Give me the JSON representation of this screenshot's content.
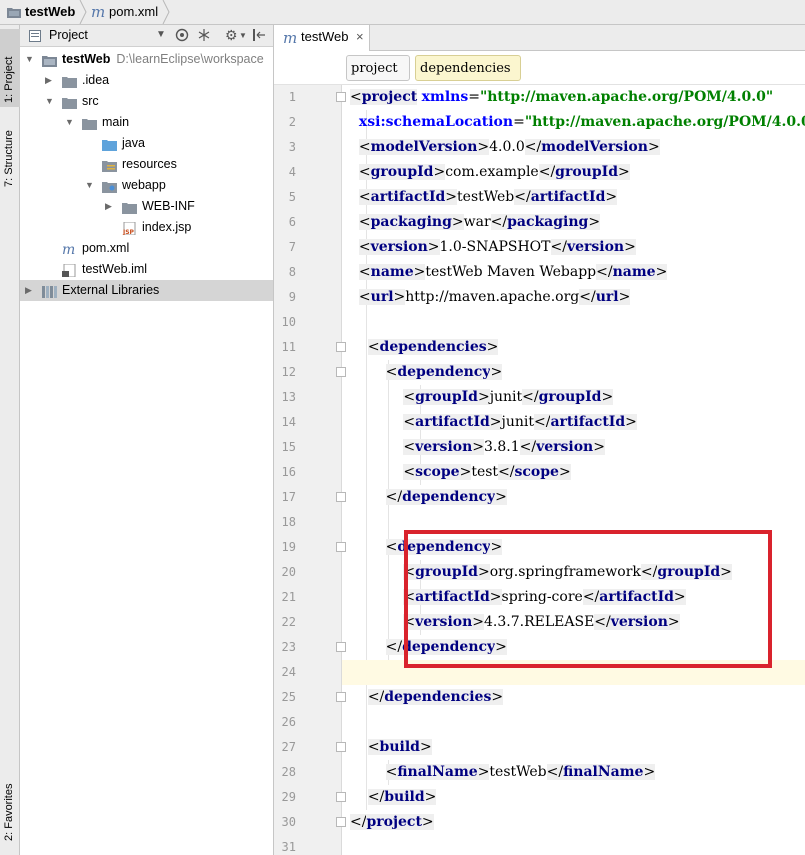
{
  "breadcrumb": {
    "project": "testWeb",
    "file": "pom.xml"
  },
  "leftstrip": {
    "project_tab": "1: Project",
    "structure_tab": "7: Structure",
    "favorites_tab": "2: Favorites"
  },
  "project_panel": {
    "title": "Project",
    "tree": [
      {
        "label": "testWeb",
        "path": "D:\\learnEclipse\\workspace",
        "indent": 0,
        "arrow": "▼",
        "icon": "module-folder-icon",
        "bold": true
      },
      {
        "label": ".idea",
        "indent": 1,
        "arrow": "▶",
        "icon": "folder-icon"
      },
      {
        "label": "src",
        "indent": 1,
        "arrow": "▼",
        "icon": "folder-icon"
      },
      {
        "label": "main",
        "indent": 2,
        "arrow": "▼",
        "icon": "folder-icon"
      },
      {
        "label": "java",
        "indent": 3,
        "arrow": "",
        "icon": "source-folder-icon"
      },
      {
        "label": "resources",
        "indent": 3,
        "arrow": "",
        "icon": "resources-folder-icon"
      },
      {
        "label": "webapp",
        "indent": 3,
        "arrow": "▼",
        "icon": "web-folder-icon"
      },
      {
        "label": "WEB-INF",
        "indent": 4,
        "arrow": "▶",
        "icon": "folder-icon"
      },
      {
        "label": "index.jsp",
        "indent": 4,
        "arrow": "",
        "icon": "jsp-file-icon"
      },
      {
        "label": "pom.xml",
        "indent": 1,
        "arrow": "",
        "icon": "maven-file-icon"
      },
      {
        "label": "testWeb.iml",
        "indent": 1,
        "arrow": "",
        "icon": "iml-file-icon"
      },
      {
        "label": "External Libraries",
        "indent": 0,
        "arrow": "▶",
        "icon": "libraries-icon",
        "selected": true
      }
    ]
  },
  "editor": {
    "tab_label": "testWeb",
    "tab_close": "×",
    "tag_breadcrumbs": [
      "project",
      "dependencies"
    ],
    "line_numbers": [
      "1",
      "2",
      "3",
      "4",
      "5",
      "6",
      "7",
      "8",
      "9",
      "10",
      "11",
      "12",
      "13",
      "14",
      "15",
      "16",
      "17",
      "18",
      "19",
      "20",
      "21",
      "22",
      "23",
      "24",
      "25",
      "26",
      "27",
      "28",
      "29",
      "30",
      "31"
    ],
    "current_line": 24
  },
  "code_lines": [
    [
      [
        "br",
        "<"
      ],
      [
        "tg",
        "project"
      ],
      [
        "txt",
        " "
      ],
      [
        "attr",
        "xmlns"
      ],
      [
        "txt",
        "="
      ],
      [
        "aval",
        "\"http://maven.apache.org/POM/4.0.0\""
      ]
    ],
    [
      [
        "txt",
        "  "
      ],
      [
        "attr",
        "xsi:schemaLocation"
      ],
      [
        "txt",
        "="
      ],
      [
        "aval",
        "\"http://maven.apache.org/POM/4.0.0"
      ]
    ],
    [
      [
        "txt",
        "  "
      ],
      [
        "br",
        "<"
      ],
      [
        "tg",
        "modelVersion"
      ],
      [
        "br",
        ">"
      ],
      [
        "txt",
        "4.0.0"
      ],
      [
        "br",
        "</"
      ],
      [
        "tg",
        "modelVersion"
      ],
      [
        "br",
        ">"
      ]
    ],
    [
      [
        "txt",
        "  "
      ],
      [
        "br",
        "<"
      ],
      [
        "tg",
        "groupId"
      ],
      [
        "br",
        ">"
      ],
      [
        "txt",
        "com.example"
      ],
      [
        "br",
        "</"
      ],
      [
        "tg",
        "groupId"
      ],
      [
        "br",
        ">"
      ]
    ],
    [
      [
        "txt",
        "  "
      ],
      [
        "br",
        "<"
      ],
      [
        "tg",
        "artifactId"
      ],
      [
        "br",
        ">"
      ],
      [
        "txt",
        "testWeb"
      ],
      [
        "br",
        "</"
      ],
      [
        "tg",
        "artifactId"
      ],
      [
        "br",
        ">"
      ]
    ],
    [
      [
        "txt",
        "  "
      ],
      [
        "br",
        "<"
      ],
      [
        "tg",
        "packaging"
      ],
      [
        "br",
        ">"
      ],
      [
        "txt",
        "war"
      ],
      [
        "br",
        "</"
      ],
      [
        "tg",
        "packaging"
      ],
      [
        "br",
        ">"
      ]
    ],
    [
      [
        "txt",
        "  "
      ],
      [
        "br",
        "<"
      ],
      [
        "tg",
        "version"
      ],
      [
        "br",
        ">"
      ],
      [
        "txt",
        "1.0-SNAPSHOT"
      ],
      [
        "br",
        "</"
      ],
      [
        "tg",
        "version"
      ],
      [
        "br",
        ">"
      ]
    ],
    [
      [
        "txt",
        "  "
      ],
      [
        "br",
        "<"
      ],
      [
        "tg",
        "name"
      ],
      [
        "br",
        ">"
      ],
      [
        "txt",
        "testWeb Maven Webapp"
      ],
      [
        "br",
        "</"
      ],
      [
        "tg",
        "name"
      ],
      [
        "br",
        ">"
      ]
    ],
    [
      [
        "txt",
        "  "
      ],
      [
        "br",
        "<"
      ],
      [
        "tg",
        "url"
      ],
      [
        "br",
        ">"
      ],
      [
        "txt",
        "http://maven.apache.org"
      ],
      [
        "br",
        "</"
      ],
      [
        "tg",
        "url"
      ],
      [
        "br",
        ">"
      ]
    ],
    [],
    [
      [
        "txt",
        "    "
      ],
      [
        "br",
        "<"
      ],
      [
        "tg",
        "dependencies"
      ],
      [
        "br",
        ">"
      ]
    ],
    [
      [
        "txt",
        "        "
      ],
      [
        "br",
        "<"
      ],
      [
        "tg",
        "dependency"
      ],
      [
        "br",
        ">"
      ]
    ],
    [
      [
        "txt",
        "            "
      ],
      [
        "br",
        "<"
      ],
      [
        "tg",
        "groupId"
      ],
      [
        "br",
        ">"
      ],
      [
        "txt",
        "junit"
      ],
      [
        "br",
        "</"
      ],
      [
        "tg",
        "groupId"
      ],
      [
        "br",
        ">"
      ]
    ],
    [
      [
        "txt",
        "            "
      ],
      [
        "br",
        "<"
      ],
      [
        "tg",
        "artifactId"
      ],
      [
        "br",
        ">"
      ],
      [
        "txt",
        "junit"
      ],
      [
        "br",
        "</"
      ],
      [
        "tg",
        "artifactId"
      ],
      [
        "br",
        ">"
      ]
    ],
    [
      [
        "txt",
        "            "
      ],
      [
        "br",
        "<"
      ],
      [
        "tg",
        "version"
      ],
      [
        "br",
        ">"
      ],
      [
        "txt",
        "3.8.1"
      ],
      [
        "br",
        "</"
      ],
      [
        "tg",
        "version"
      ],
      [
        "br",
        ">"
      ]
    ],
    [
      [
        "txt",
        "            "
      ],
      [
        "br",
        "<"
      ],
      [
        "tg",
        "scope"
      ],
      [
        "br",
        ">"
      ],
      [
        "txt",
        "test"
      ],
      [
        "br",
        "</"
      ],
      [
        "tg",
        "scope"
      ],
      [
        "br",
        ">"
      ]
    ],
    [
      [
        "txt",
        "        "
      ],
      [
        "br",
        "</"
      ],
      [
        "tg",
        "dependency"
      ],
      [
        "br",
        ">"
      ]
    ],
    [],
    [
      [
        "txt",
        "        "
      ],
      [
        "br",
        "<"
      ],
      [
        "tg",
        "dependency"
      ],
      [
        "br",
        ">"
      ]
    ],
    [
      [
        "txt",
        "            "
      ],
      [
        "br",
        "<"
      ],
      [
        "tg",
        "groupId"
      ],
      [
        "br",
        ">"
      ],
      [
        "txt",
        "org.springframework"
      ],
      [
        "br",
        "</"
      ],
      [
        "tg",
        "groupId"
      ],
      [
        "br",
        ">"
      ]
    ],
    [
      [
        "txt",
        "            "
      ],
      [
        "br",
        "<"
      ],
      [
        "tg",
        "artifactId"
      ],
      [
        "br",
        ">"
      ],
      [
        "txt",
        "spring-core"
      ],
      [
        "br",
        "</"
      ],
      [
        "tg",
        "artifactId"
      ],
      [
        "br",
        ">"
      ]
    ],
    [
      [
        "txt",
        "            "
      ],
      [
        "br",
        "<"
      ],
      [
        "tg",
        "version"
      ],
      [
        "br",
        ">"
      ],
      [
        "txt",
        "4.3.7.RELEASE"
      ],
      [
        "br",
        "</"
      ],
      [
        "tg",
        "version"
      ],
      [
        "br",
        ">"
      ]
    ],
    [
      [
        "txt",
        "        "
      ],
      [
        "br",
        "</"
      ],
      [
        "tg",
        "dependency"
      ],
      [
        "br",
        ">"
      ]
    ],
    [],
    [
      [
        "txt",
        "    "
      ],
      [
        "br",
        "</"
      ],
      [
        "tg",
        "dependencies"
      ],
      [
        "br",
        ">"
      ]
    ],
    [],
    [
      [
        "txt",
        "    "
      ],
      [
        "br",
        "<"
      ],
      [
        "tg",
        "build"
      ],
      [
        "br",
        ">"
      ]
    ],
    [
      [
        "txt",
        "        "
      ],
      [
        "br",
        "<"
      ],
      [
        "tg",
        "finalName"
      ],
      [
        "br",
        ">"
      ],
      [
        "txt",
        "testWeb"
      ],
      [
        "br",
        "</"
      ],
      [
        "tg",
        "finalName"
      ],
      [
        "br",
        ">"
      ]
    ],
    [
      [
        "txt",
        "    "
      ],
      [
        "br",
        "</"
      ],
      [
        "tg",
        "build"
      ],
      [
        "br",
        ">"
      ]
    ],
    [
      [
        "br",
        "</"
      ],
      [
        "tg",
        "project"
      ],
      [
        "br",
        ">"
      ]
    ],
    []
  ],
  "fold_markers": [
    1,
    11,
    12,
    17,
    19,
    23,
    25,
    27,
    29,
    30
  ],
  "colors": {
    "highlight_box": "#d9232d",
    "tag": "#000080",
    "attr_value": "#008000",
    "attr_name": "#0000ff",
    "current_line": "#fffae3"
  }
}
